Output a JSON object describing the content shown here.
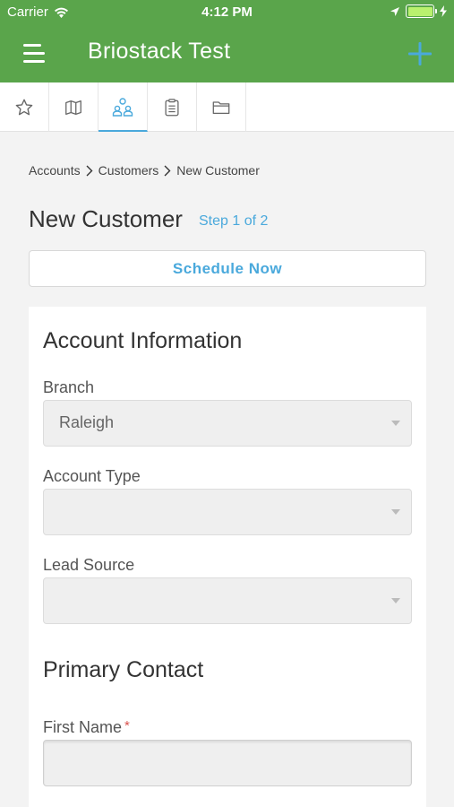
{
  "status_bar": {
    "carrier": "Carrier",
    "time": "4:12 PM"
  },
  "nav": {
    "title": "Briostack Test",
    "add_icon": "plus-icon",
    "menu_icon": "hamburger-icon"
  },
  "tabs": [
    {
      "icon": "star-icon",
      "active": false
    },
    {
      "icon": "map-icon",
      "active": false
    },
    {
      "icon": "people-icon",
      "active": true
    },
    {
      "icon": "clipboard-icon",
      "active": false
    },
    {
      "icon": "folder-icon",
      "active": false
    }
  ],
  "breadcrumb": {
    "items": [
      "Accounts",
      "Customers",
      "New Customer"
    ]
  },
  "page": {
    "title": "New Customer",
    "step": "Step 1 of 2",
    "schedule_button": "Schedule Now"
  },
  "account_info": {
    "heading": "Account Information",
    "branch": {
      "label": "Branch",
      "value": "Raleigh"
    },
    "account_type": {
      "label": "Account Type",
      "value": ""
    },
    "lead_source": {
      "label": "Lead Source",
      "value": ""
    }
  },
  "primary_contact": {
    "heading": "Primary Contact",
    "first_name": {
      "label": "First Name",
      "required_mark": "*",
      "value": ""
    }
  },
  "colors": {
    "header": "#5aa54b",
    "accent": "#4aa9dc",
    "required": "#d9534f"
  }
}
